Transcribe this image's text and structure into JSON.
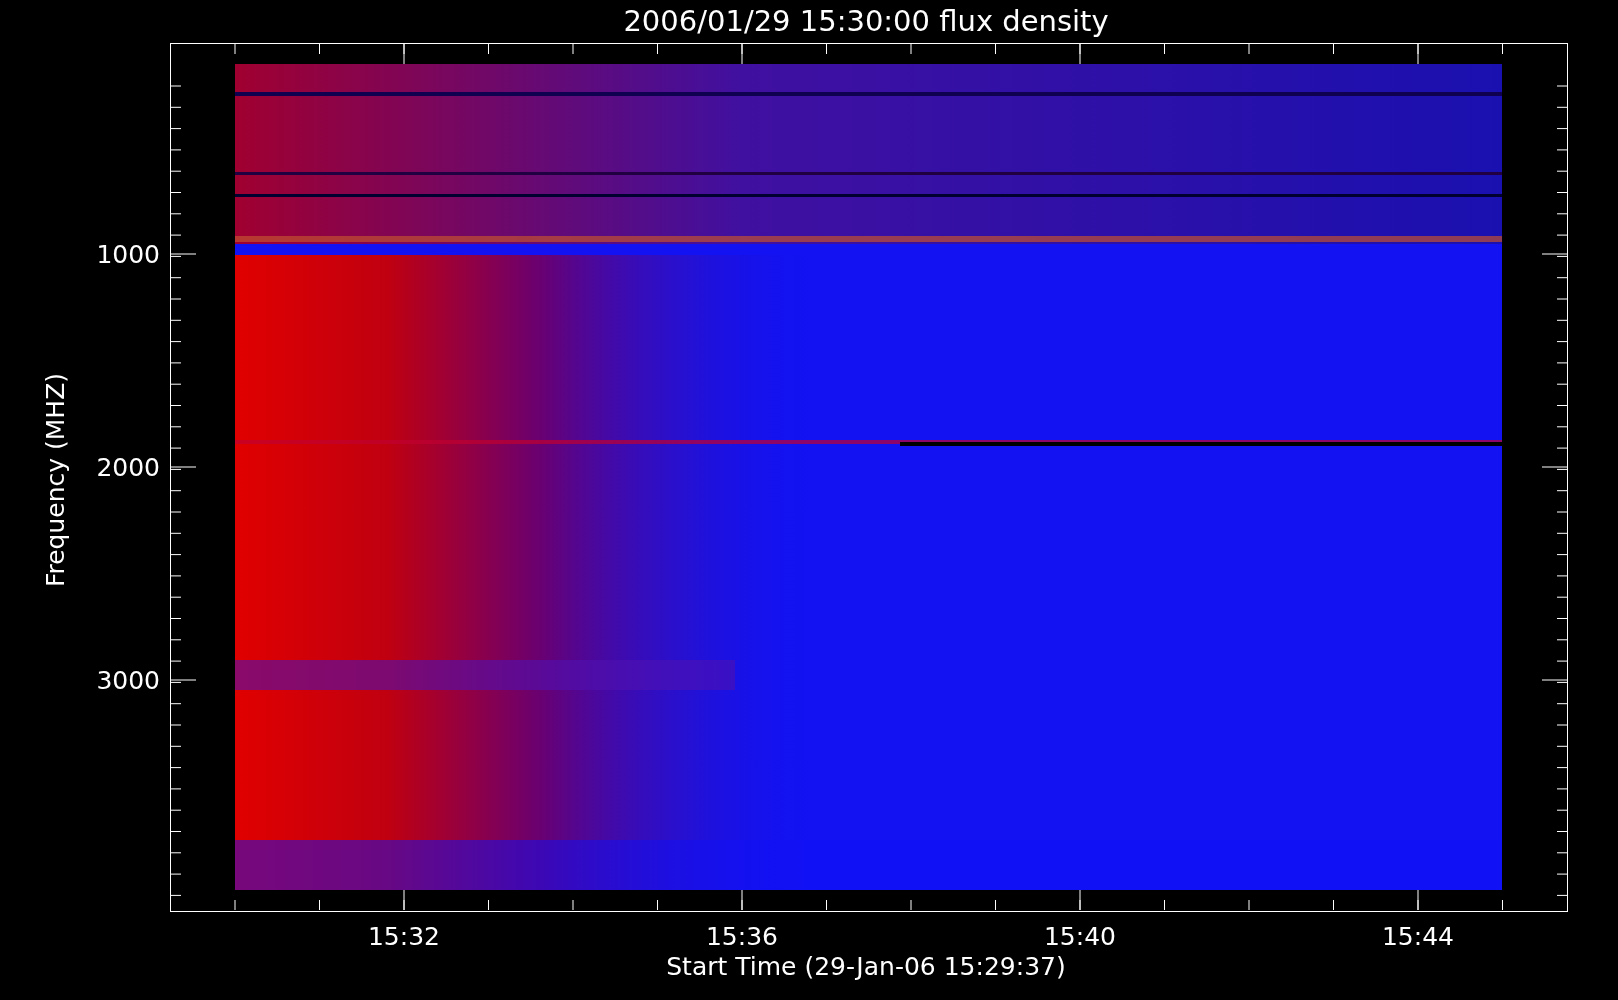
{
  "title": "2006/01/29 15:30:00 flux density",
  "y_axis": {
    "label": "Frequency (MHZ)",
    "ticks": [
      "1000",
      "2000",
      "3000"
    ]
  },
  "x_axis": {
    "label": "Start Time (29-Jan-06 15:29:37)",
    "ticks": [
      "15:32",
      "15:36",
      "15:40",
      "15:44"
    ]
  }
}
